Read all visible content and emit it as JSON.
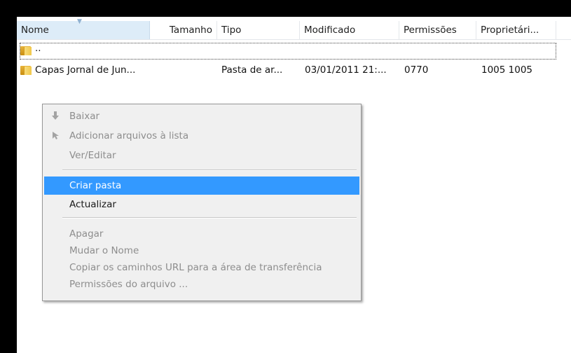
{
  "columns": {
    "name": "Nome",
    "size": "Tamanho",
    "type": "Tipo",
    "modified": "Modificado",
    "permissions": "Permissões",
    "owner": "Proprietári..."
  },
  "rows": [
    {
      "name": "..",
      "icon": "folder-icon"
    },
    {
      "name": "Capas Jornal de Jun...",
      "size": "",
      "type": "Pasta de ar...",
      "modified": "03/01/2011 21:...",
      "permissions": "0770",
      "owner": "1005 1005",
      "icon": "folder-icon"
    }
  ],
  "context_menu": {
    "items": [
      {
        "label": "Baixar",
        "enabled": false,
        "icon": "download-arrow-icon"
      },
      {
        "label": "Adicionar arquivos à lista",
        "enabled": false,
        "icon": "add-to-queue-icon"
      },
      {
        "label": "Ver/Editar",
        "enabled": false
      },
      {
        "label": "Criar pasta",
        "enabled": true,
        "highlighted": true
      },
      {
        "label": "Actualizar",
        "enabled": true
      },
      {
        "label": "Apagar",
        "enabled": false
      },
      {
        "label": "Mudar o Nome",
        "enabled": false
      },
      {
        "label": "Copiar os caminhos URL para a área de transferência",
        "enabled": false
      },
      {
        "label": "Permissões do arquivo ...",
        "enabled": false
      }
    ]
  },
  "colors": {
    "highlight": "#3399ff",
    "sorted_column": "#ddecf8",
    "disabled_text": "#8d8d8d"
  }
}
